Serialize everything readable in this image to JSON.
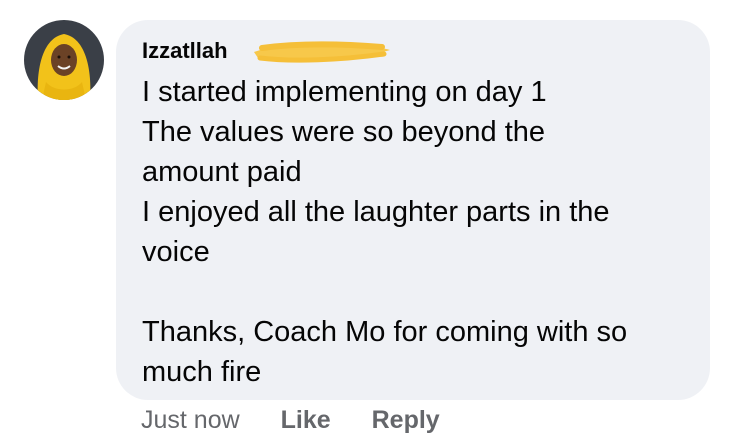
{
  "comment": {
    "author_name": "Izzatllah",
    "avatar_icon": "user-avatar-photo",
    "lines": [
      "I started implementing on day 1",
      "The values were so beyond the",
      "amount paid",
      "I enjoyed all the laughter parts in the",
      "voice",
      "",
      "Thanks, Coach Mo for coming with so",
      "much fire"
    ],
    "timestamp": "Just now",
    "like_label": "Like",
    "reply_label": "Reply",
    "bubble_color": "#eff1f5",
    "redaction_color": "#f7c84a"
  }
}
